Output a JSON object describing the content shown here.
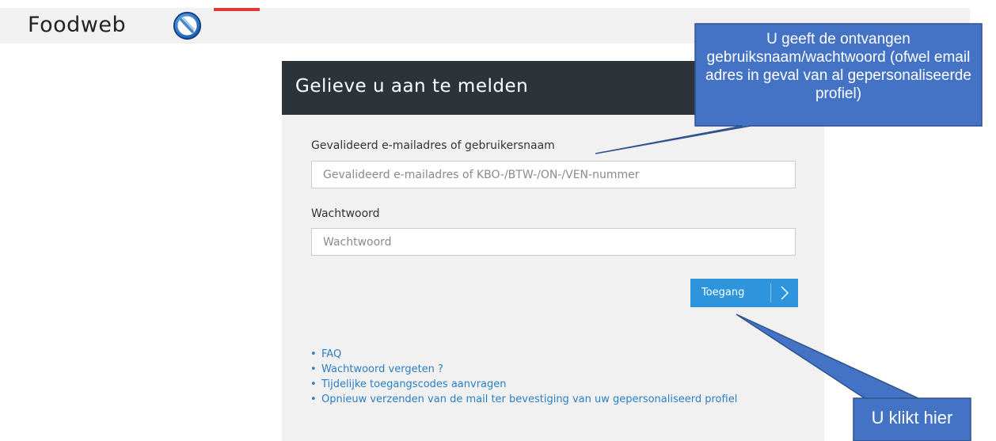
{
  "header": {
    "logo_text": "Foodweb",
    "logo_icon": "fork-knife-icon"
  },
  "login": {
    "title": "Gelieve u aan te melden",
    "username_label": "Gevalideerd e-mailadres of gebruikersnaam",
    "username_placeholder": "Gevalideerd e-mailadres of KBO-/BTW-/ON-/VEN-nummer",
    "username_value": "",
    "password_label": "Wachtwoord",
    "password_placeholder": "Wachtwoord",
    "password_value": "",
    "submit_label": "Toegang",
    "submit_icon": "chevron-right-icon"
  },
  "links": [
    "FAQ",
    "Wachtwoord vergeten ?",
    "Tijdelijke toegangscodes aanvragen",
    "Opnieuw verzenden van de mail ter bevestiging van uw gepersonaliseerd profiel"
  ],
  "callouts": {
    "credentials": "U geeft de ontvangen gebruiksnaam/wachtwoord (ofwel email adres in geval van al gepersonaliseerde profiel)",
    "click": "U klikt hier"
  },
  "colors": {
    "header_bg": "#2d3439",
    "panel_bg": "#f1f1f1",
    "button_bg": "#2e95dd",
    "link": "#2a7fc4",
    "callout_fill": "#4472c4",
    "callout_border": "#2f528f",
    "brand_red": "#e53935"
  }
}
